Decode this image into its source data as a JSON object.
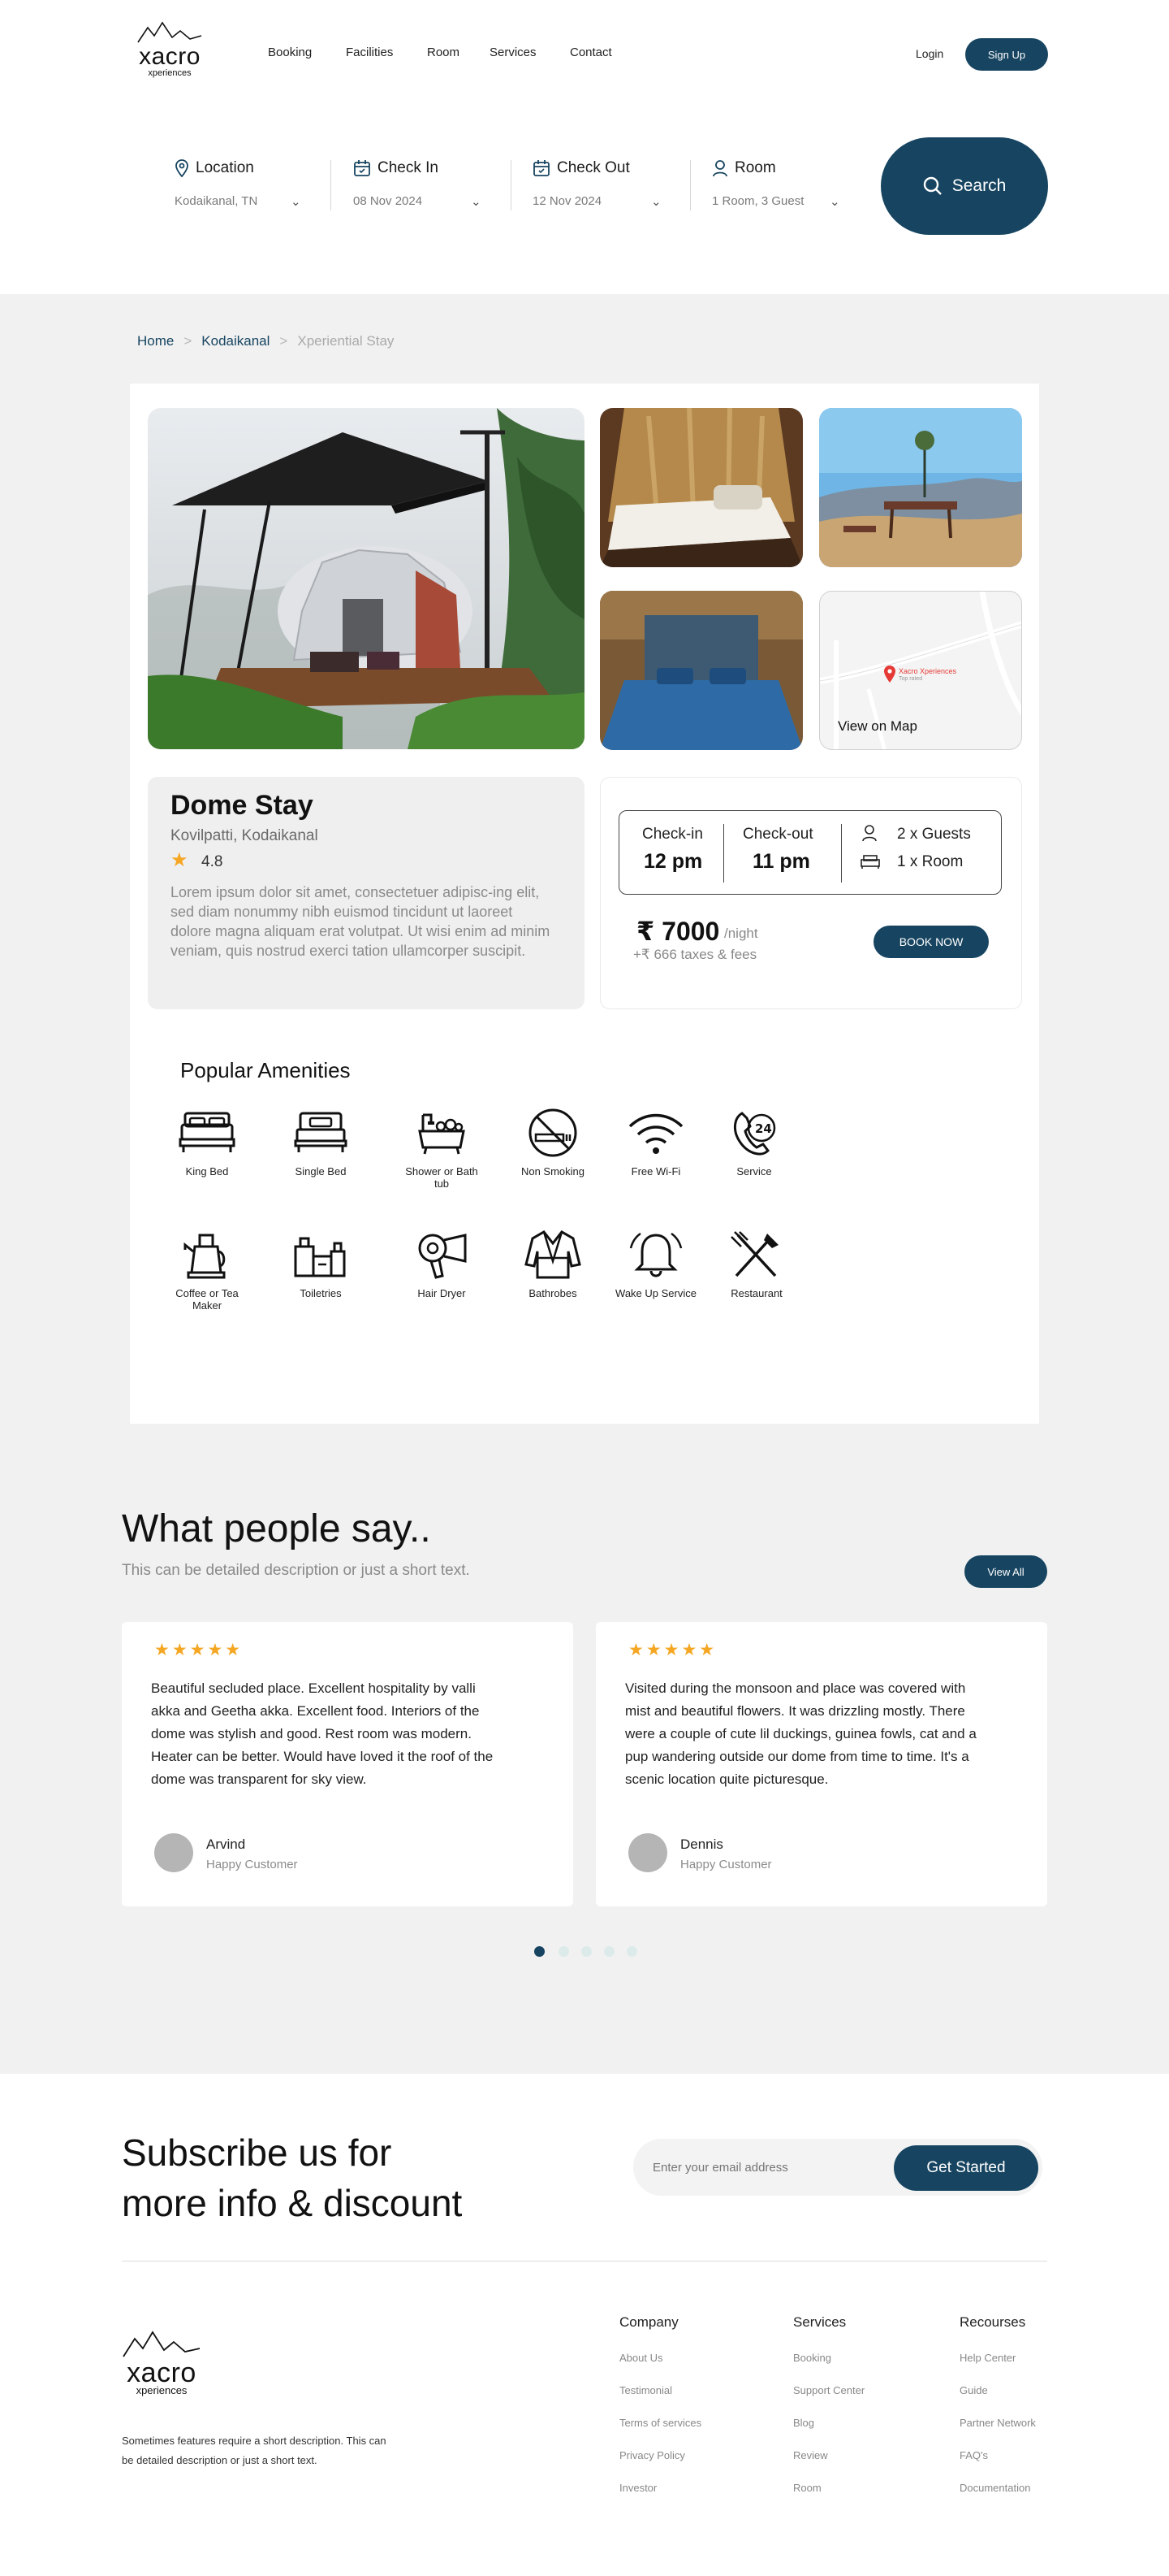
{
  "nav": {
    "logo_main": "xacro",
    "logo_sub": "xperiences",
    "links": [
      "Booking",
      "Facilities",
      "Room",
      "Services",
      "Contact"
    ],
    "login": "Login",
    "signup": "Sign Up"
  },
  "search": {
    "location_label": "Location",
    "location_value": "Kodaikanal, TN",
    "checkin_label": "Check In",
    "checkin_value": "08 Nov 2024",
    "checkout_label": "Check Out",
    "checkout_value": "12 Nov 2024",
    "room_label": "Room",
    "room_value": "1 Room, 3 Guest",
    "button": "Search"
  },
  "breadcrumb": [
    "Home",
    "Kodaikanal",
    "Xperiential Stay"
  ],
  "gallery": {
    "map_label": "View on Map",
    "map_pin_title": "Xacro Xperiences",
    "map_pin_sub": "Top rated"
  },
  "property": {
    "name": "Dome Stay",
    "location": "Kovilpatti, Kodaikanal",
    "rating": "4.8",
    "description": "Lorem ipsum dolor sit amet, consectetuer adipisc-ing elit, sed diam nonummy nibh euismod tincidunt ut laoreet dolore magna aliquam erat volutpat. Ut wisi enim ad minim veniam, quis nostrud exerci tation ullamcorper suscipit."
  },
  "booking": {
    "checkin_label": "Check-in",
    "checkin_time": "12 pm",
    "checkout_label": "Check-out",
    "checkout_time": "11 pm",
    "guests": "2 x Guests",
    "rooms": "1 x Room",
    "price": "₹ 7000",
    "per_night": "/night",
    "taxes": "+₹ 666 taxes & fees",
    "book_button": "BOOK NOW"
  },
  "amenities": {
    "title": "Popular Amenities",
    "items": [
      {
        "label": "King Bed",
        "icon": "king-bed-icon"
      },
      {
        "label": "Single Bed",
        "icon": "single-bed-icon"
      },
      {
        "label": "Shower or Bath tub",
        "icon": "bathtub-icon"
      },
      {
        "label": "Non Smoking",
        "icon": "no-smoking-icon"
      },
      {
        "label": "Free Wi-Fi",
        "icon": "wifi-icon"
      },
      {
        "label": "Service",
        "icon": "service-24h-icon"
      },
      {
        "label": "Coffee or Tea Maker",
        "icon": "kettle-icon"
      },
      {
        "label": "Toiletries",
        "icon": "toiletries-icon"
      },
      {
        "label": "Hair Dryer",
        "icon": "hair-dryer-icon"
      },
      {
        "label": "Bathrobes",
        "icon": "bathrobe-icon"
      },
      {
        "label": "Wake Up Service",
        "icon": "bell-icon"
      },
      {
        "label": "Restaurant",
        "icon": "restaurant-icon"
      }
    ]
  },
  "testimonials": {
    "title": "What people say..",
    "subtitle": "This can be detailed description or just a short text.",
    "view_all": "View All",
    "stars": "★★★★★",
    "items": [
      {
        "text": "Beautiful secluded place. Excellent hospitality by valli akka and Geetha akka. Excellent food. Interiors of the dome was stylish and good. Rest room was modern. Heater can be better. Would have loved it the roof of the dome was transparent for sky view.",
        "name": "Arvind",
        "role": "Happy Customer"
      },
      {
        "text": "Visited during the monsoon and place was covered with mist and beautiful flowers. It was drizzling mostly. There were a couple of cute lil duckings, guinea fowls, cat and a pup wandering outside our dome from time to time. It's a scenic location quite picturesque.",
        "name": "Dennis",
        "role": "Happy Customer"
      }
    ],
    "active_dot": 1,
    "dot_count": 5
  },
  "subscribe": {
    "title_line1": "Subscribe us for",
    "title_line2": "more info & discount",
    "placeholder": "Enter your email address",
    "button": "Get Started"
  },
  "footer": {
    "logo_main": "xacro",
    "logo_sub": "xperiences",
    "description": "Sometimes features require a short description. This can be detailed description or just a short text.",
    "company_title": "Company",
    "company_links": [
      "About Us",
      "Testimonial",
      "Terms of services",
      "Privacy Policy",
      "Investor"
    ],
    "services_title": "Services",
    "services_links": [
      "Booking",
      "Support Center",
      "Blog",
      "Review",
      "Room"
    ],
    "resources_title": "Recourses",
    "resources_links": [
      "Help Center",
      "Guide",
      "Partner Network",
      "FAQ's",
      "Documentation"
    ]
  },
  "colors": {
    "brand": "#174561",
    "star": "#f5a623",
    "band": "#f1f1f1"
  }
}
